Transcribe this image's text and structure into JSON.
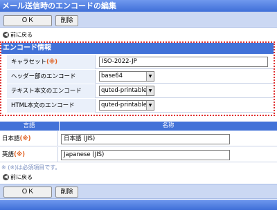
{
  "title": "メール送信時のエンコードの編集",
  "buttons": {
    "ok": "ＯＫ",
    "delete": "削除"
  },
  "back_link": "前に戻る",
  "encoding_section": {
    "header": "エンコード情報",
    "required_mark": "(※)",
    "rows": [
      {
        "label": "キャラセット",
        "required": true,
        "type": "text",
        "value": "ISO-2022-JP"
      },
      {
        "label": "ヘッダー部のエンコード",
        "required": false,
        "type": "select",
        "value": "base64"
      },
      {
        "label": "テキスト本文のエンコード",
        "required": false,
        "type": "select",
        "value": "quted-printable"
      },
      {
        "label": "HTML本文のエンコード",
        "required": false,
        "type": "select",
        "value": "quted-printable"
      }
    ]
  },
  "language_table": {
    "headers": {
      "language": "言語",
      "name": "名称"
    },
    "rows": [
      {
        "language": "日本語",
        "value": "日本語 (JIS)"
      },
      {
        "language": "英語",
        "value": "Japanese (JIS)"
      }
    ]
  },
  "required_note": "※ (※)は必須項目です。"
}
